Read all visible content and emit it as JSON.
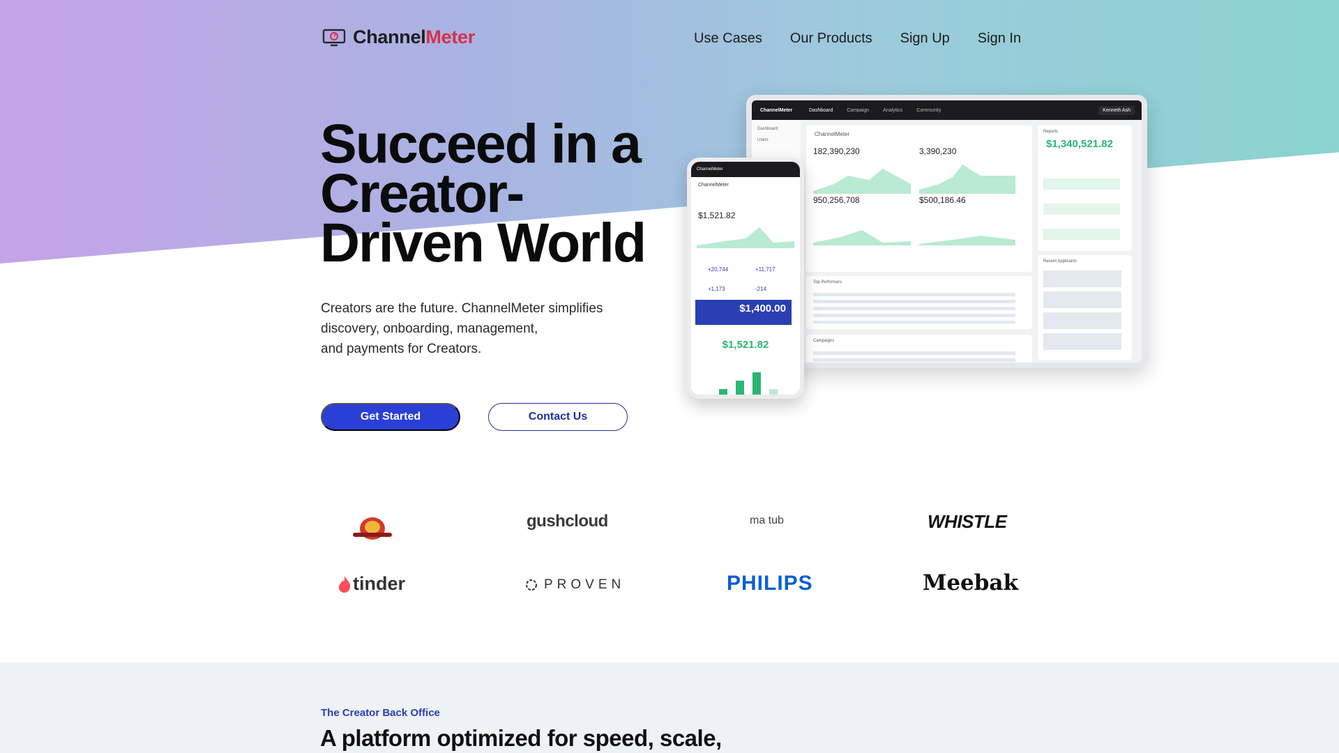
{
  "header": {
    "logo_part1": "Channel",
    "logo_part2": "Meter",
    "nav": [
      "Use Cases",
      "Our Products",
      "Sign Up",
      "Sign In"
    ]
  },
  "hero": {
    "title_lines": [
      "Succeed in a",
      "Creator-",
      "Driven World"
    ],
    "subtitle_lines": [
      "Creators are the future. ChannelMeter simplifies",
      "discovery, onboarding, management,",
      "and payments for Creators."
    ],
    "primary_button": "Get Started",
    "secondary_button": "Contact Us"
  },
  "dashboard": {
    "brand": "ChannelMeter",
    "tabs": [
      "Dashboard",
      "Campaign",
      "Analytics",
      "Community"
    ],
    "user": "Kenneth Ash",
    "sidebar": [
      "Dashboard",
      "Users"
    ],
    "header": "ChannelMeter",
    "stats": [
      "182,390,230",
      "3,390,230",
      "950,256,708",
      "$500,186.46"
    ],
    "reports_label": "Reports",
    "reports_value": "$1,340,521.82",
    "top_performers": "Top Performers",
    "campaigns": "Campaigns",
    "recent_applicants": "Recent Applicants"
  },
  "phone": {
    "brand": "ChannelMeter",
    "header": "ChannelMeter",
    "value1": "$1,521.82",
    "views": "+20,744",
    "monetized": "+11,717",
    "engagement": "+1,173",
    "subscribers": "-214",
    "blue_value": "$1,400.00",
    "green_value": "$1,521.82"
  },
  "logos": [
    "gushcloud",
    "ma tub",
    "WHISTLE",
    "tinder",
    "PROVEN",
    "PHILIPS",
    "Meebak"
  ],
  "section2": {
    "eyebrow": "The Creator Back Office",
    "title": "A platform optimized for speed, scale,"
  },
  "colors": {
    "primary": "#2a3fd6",
    "brand_red": "#d6304a",
    "green": "#2bb673"
  }
}
